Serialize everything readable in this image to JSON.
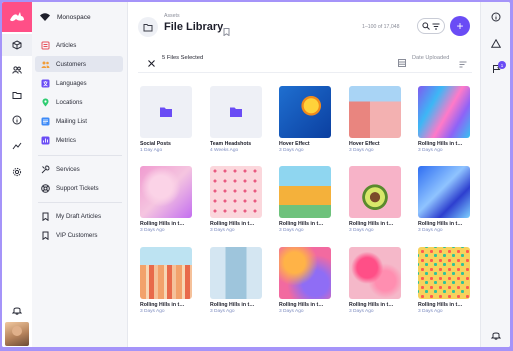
{
  "workspace": {
    "name": "Monospace"
  },
  "sidebar": {
    "items": [
      {
        "label": "Articles",
        "icon": "article-icon",
        "color": "#e8505b"
      },
      {
        "label": "Customers",
        "icon": "users-icon",
        "color": "#f19c38"
      },
      {
        "label": "Languages",
        "icon": "translate-icon",
        "color": "#6a4cf5"
      },
      {
        "label": "Locations",
        "icon": "map-pin-icon",
        "color": "#2ecc71"
      },
      {
        "label": "Mailing List",
        "icon": "mail-list-icon",
        "color": "#3d8af7"
      },
      {
        "label": "Metrics",
        "icon": "metrics-icon",
        "color": "#6a4cf5"
      },
      {
        "label": "Services",
        "icon": "wrench-icon",
        "color": "#2a2c38"
      },
      {
        "label": "Support Tickets",
        "icon": "support-icon",
        "color": "#2a2c38"
      },
      {
        "label": "My Draft Articles",
        "icon": "bookmark-icon",
        "color": "#2a2c38"
      },
      {
        "label": "VIP Customers",
        "icon": "bookmark-icon",
        "color": "#2a2c38"
      }
    ],
    "active_index": 1
  },
  "header": {
    "breadcrumb": "Assets",
    "title": "File Library",
    "pagination": "1–100 of 17,048",
    "add_label": "+"
  },
  "selection": {
    "count_label": "5 Files Selected",
    "sort_label": "Date Uploaded"
  },
  "files": [
    {
      "name": "Social Posts",
      "meta": "1 Day Ago",
      "kind": "folder"
    },
    {
      "name": "Team Headshots",
      "meta": "4 Weeks Ago",
      "kind": "folder"
    },
    {
      "name": "Hover Effect",
      "meta": "3 Days Ago",
      "kind": "image",
      "art": "lemon"
    },
    {
      "name": "Hover Effect",
      "meta": "3 Days Ago",
      "kind": "image",
      "art": "pinkbuilding"
    },
    {
      "name": "Rolling Hills in t…",
      "meta": "3 Days Ago",
      "kind": "image",
      "art": "marble"
    },
    {
      "name": "Rolling Hills in t…",
      "meta": "3 Days Ago",
      "kind": "image",
      "art": "crystal"
    },
    {
      "name": "Rolling Hills in t…",
      "meta": "3 Days Ago",
      "kind": "image",
      "art": "pattern"
    },
    {
      "name": "Rolling Hills in t…",
      "meta": "3 Days Ago",
      "kind": "image",
      "art": "house"
    },
    {
      "name": "Rolling Hills in t…",
      "meta": "3 Days Ago",
      "kind": "image",
      "art": "avocado"
    },
    {
      "name": "Rolling Hills in t…",
      "meta": "3 Days Ago",
      "kind": "image",
      "art": "bluewave"
    },
    {
      "name": "Rolling Hills in t…",
      "meta": "3 Days Ago",
      "kind": "image",
      "art": "bottles"
    },
    {
      "name": "Rolling Hills in t…",
      "meta": "3 Days Ago",
      "kind": "image",
      "art": "door"
    },
    {
      "name": "Rolling Hills in t…",
      "meta": "3 Days Ago",
      "kind": "image",
      "art": "blur"
    },
    {
      "name": "Rolling Hills in t…",
      "meta": "3 Days Ago",
      "kind": "image",
      "art": "flowers"
    },
    {
      "name": "Rolling Hills in t…",
      "meta": "3 Days Ago",
      "kind": "image",
      "art": "candy"
    }
  ],
  "right_panel": {
    "notification_count": "1"
  },
  "colors": {
    "accent": "#6a4cf5",
    "brand": "#ff4f87",
    "frame": "#a594f9"
  }
}
